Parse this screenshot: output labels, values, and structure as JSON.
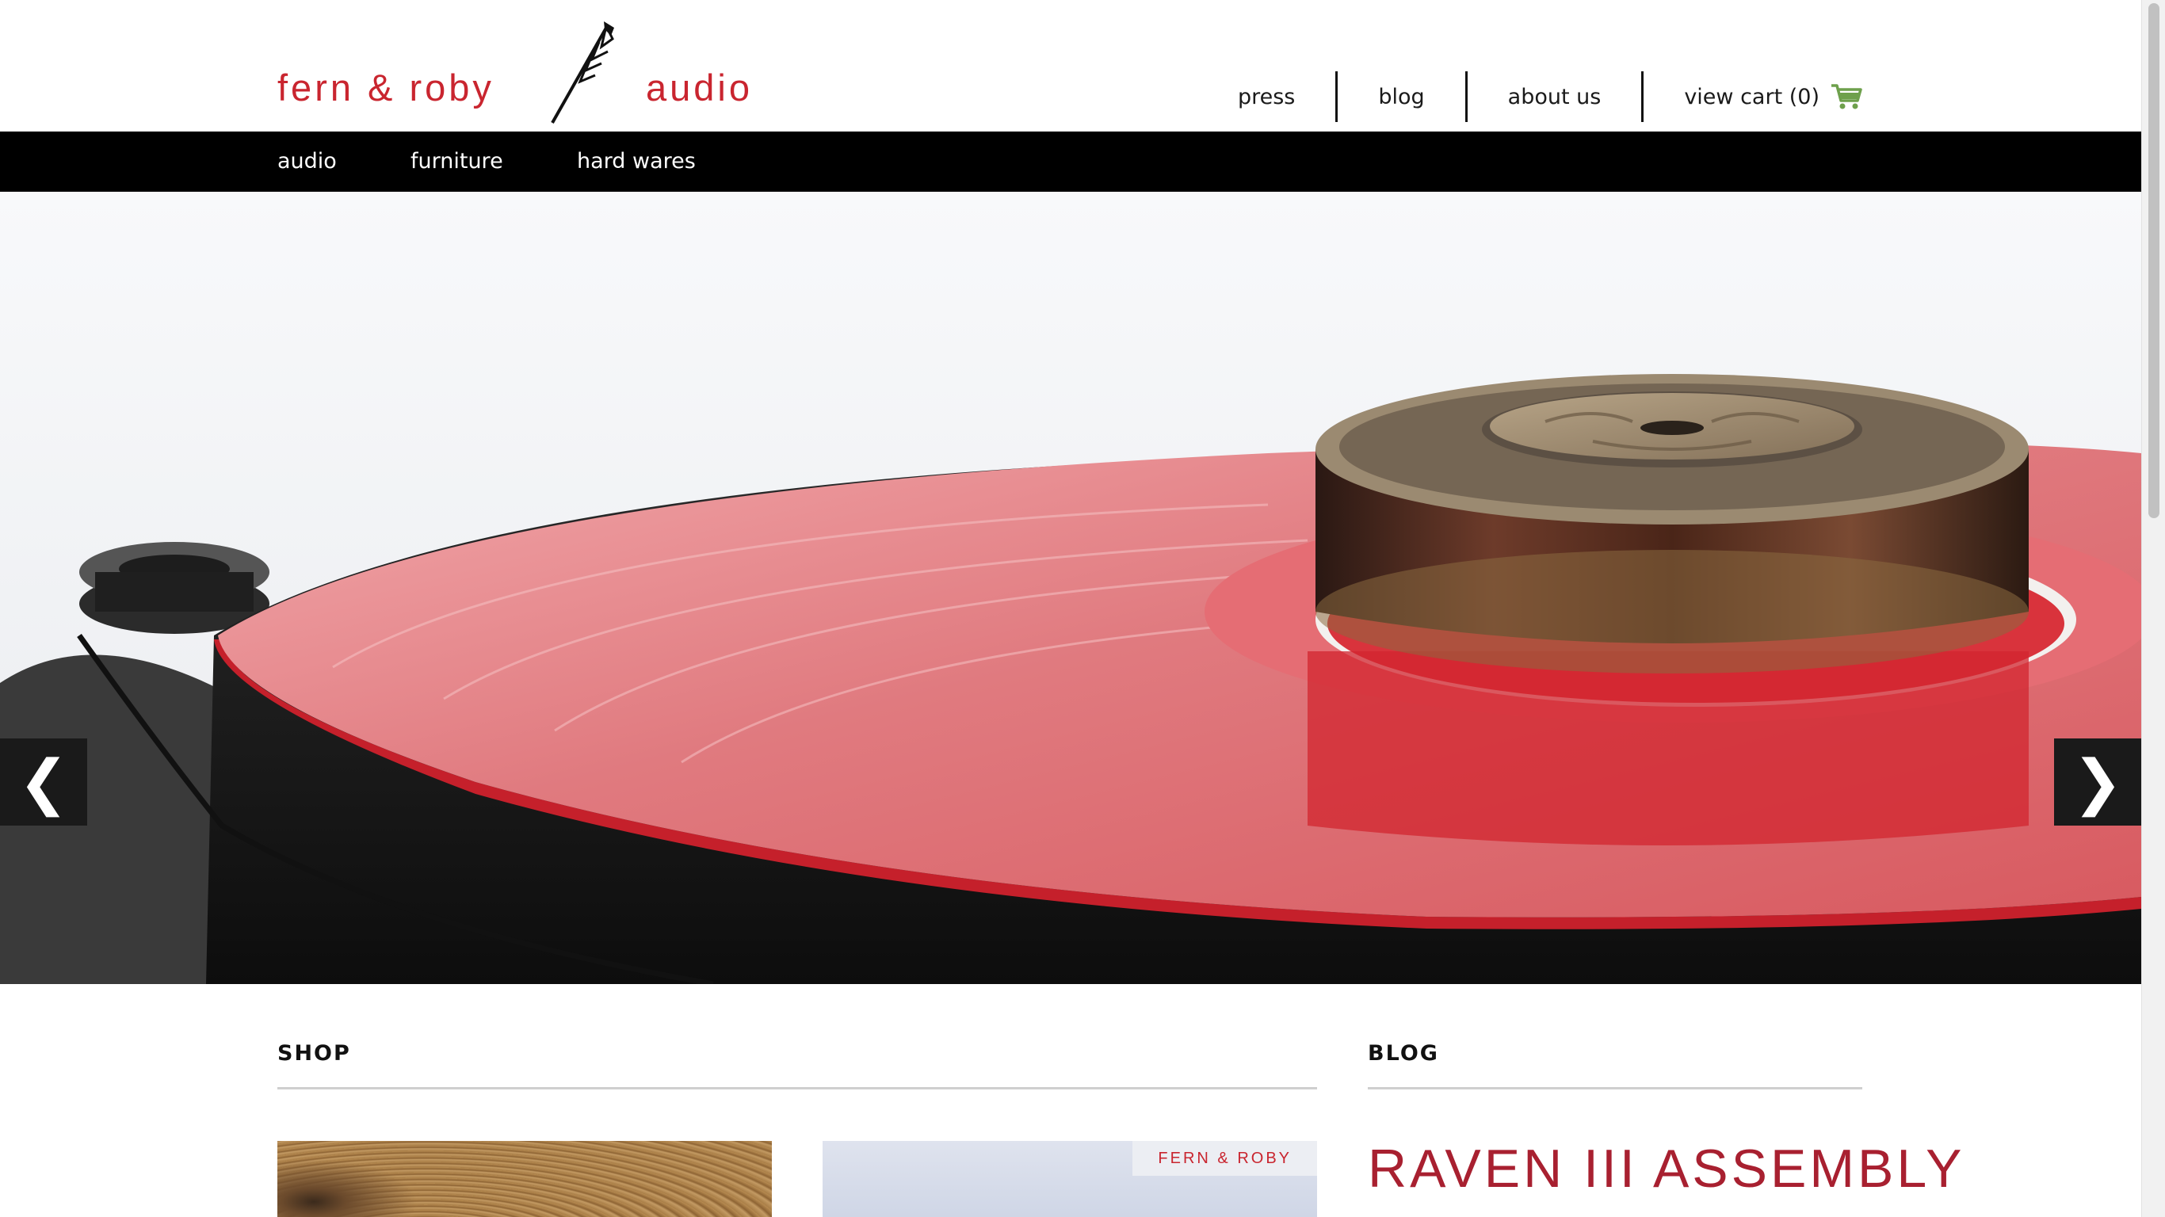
{
  "brand": {
    "name_left": "fern & roby",
    "name_right": "audio",
    "color": "#c9252f",
    "logo_icon": "arrow-icon"
  },
  "top_nav": [
    {
      "label": "press"
    },
    {
      "label": "blog"
    },
    {
      "label": "about us"
    },
    {
      "label": "view cart (0)",
      "icon": "cart-icon"
    }
  ],
  "category_nav": [
    {
      "label": "audio"
    },
    {
      "label": "furniture"
    },
    {
      "label": "hard wares"
    }
  ],
  "hero": {
    "image": "red vinyl record on turntable with brass record weight",
    "prev_label": "❮",
    "next_label": "❯"
  },
  "shop": {
    "title": "SHOP",
    "cards": [
      {
        "image": "wood grain"
      },
      {
        "image": "product photo",
        "tag": "FERN & ROBY"
      }
    ]
  },
  "blog": {
    "title": "BLOG",
    "post_title": "RAVEN III ASSEMBLY"
  },
  "colors": {
    "accent": "#c9252f",
    "nav_bar": "#000000",
    "cart_icon": "#6ea04c",
    "blog_title": "#a82030"
  }
}
